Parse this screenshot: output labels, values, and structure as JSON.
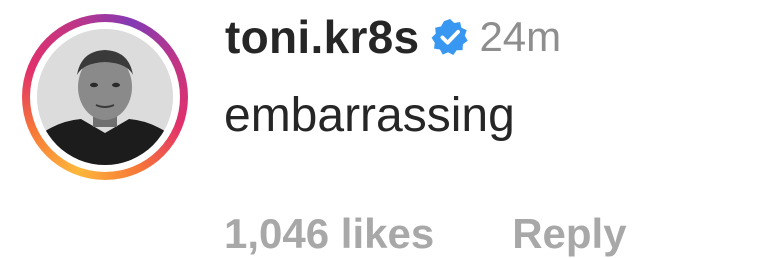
{
  "comment": {
    "username": "toni.kr8s",
    "verified_icon": "verified-badge-icon",
    "timestamp": "24m",
    "text": "embarrassing",
    "likes_label": "1,046 likes",
    "reply_label": "Reply"
  },
  "colors": {
    "text_primary": "#262626",
    "text_secondary": "#8e8e8e",
    "footer_text": "#a8a8a8",
    "verified_blue": "#3897f0",
    "story_ring": [
      "#fdb83b",
      "#f77737",
      "#e1306c",
      "#c13584",
      "#833ab4"
    ]
  }
}
